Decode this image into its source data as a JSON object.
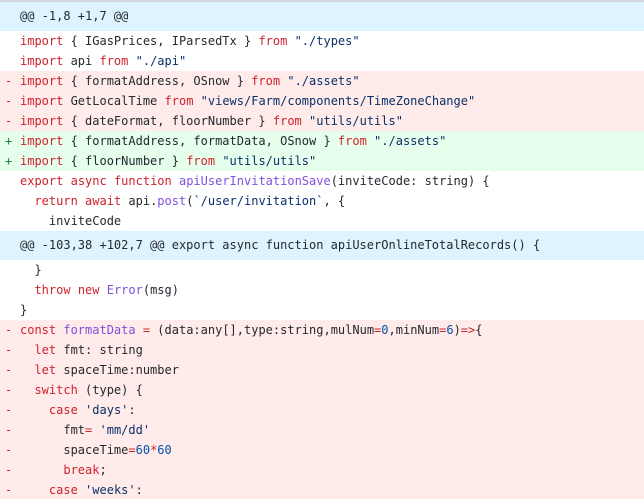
{
  "colors": {
    "hunk_bg": "#ddf4ff",
    "deleted_bg": "#ffebe9",
    "added_bg": "#e6ffec",
    "keyword": "#cf222e",
    "string": "#0a3069",
    "function": "#8250df",
    "number": "#0550ae"
  },
  "diff": {
    "lines": [
      {
        "type": "hunk",
        "sign": "",
        "tokens": [
          {
            "t": "plain",
            "v": "@@ -1,8 +1,7 @@"
          }
        ]
      },
      {
        "type": "ctx",
        "sign": "",
        "tokens": [
          {
            "t": "kw",
            "v": "import"
          },
          {
            "t": "plain",
            "v": " { IGasPrices, IParsedTx } "
          },
          {
            "t": "kw",
            "v": "from"
          },
          {
            "t": "plain",
            "v": " "
          },
          {
            "t": "str",
            "v": "\"./types\""
          }
        ]
      },
      {
        "type": "ctx",
        "sign": "",
        "tokens": [
          {
            "t": "kw",
            "v": "import"
          },
          {
            "t": "plain",
            "v": " api "
          },
          {
            "t": "kw",
            "v": "from"
          },
          {
            "t": "plain",
            "v": " "
          },
          {
            "t": "str",
            "v": "\"./api\""
          }
        ]
      },
      {
        "type": "del",
        "sign": "-",
        "tokens": [
          {
            "t": "kw",
            "v": "import"
          },
          {
            "t": "plain",
            "v": " { formatAddress, OSnow } "
          },
          {
            "t": "kw",
            "v": "from"
          },
          {
            "t": "plain",
            "v": " "
          },
          {
            "t": "str",
            "v": "\"./assets\""
          }
        ]
      },
      {
        "type": "del",
        "sign": "-",
        "tokens": [
          {
            "t": "kw",
            "v": "import"
          },
          {
            "t": "plain",
            "v": " GetLocalTime "
          },
          {
            "t": "kw",
            "v": "from"
          },
          {
            "t": "plain",
            "v": " "
          },
          {
            "t": "str",
            "v": "\"views/Farm/components/TimeZoneChange\""
          }
        ]
      },
      {
        "type": "del",
        "sign": "-",
        "tokens": [
          {
            "t": "kw",
            "v": "import"
          },
          {
            "t": "plain",
            "v": " { dateFormat, floorNumber } "
          },
          {
            "t": "kw",
            "v": "from"
          },
          {
            "t": "plain",
            "v": " "
          },
          {
            "t": "str",
            "v": "\"utils/utils\""
          }
        ]
      },
      {
        "type": "add",
        "sign": "+",
        "tokens": [
          {
            "t": "kw",
            "v": "import"
          },
          {
            "t": "plain",
            "v": " { formatAddress, formatData, OSnow } "
          },
          {
            "t": "kw",
            "v": "from"
          },
          {
            "t": "plain",
            "v": " "
          },
          {
            "t": "str",
            "v": "\"./assets\""
          }
        ]
      },
      {
        "type": "add",
        "sign": "+",
        "tokens": [
          {
            "t": "kw",
            "v": "import"
          },
          {
            "t": "plain",
            "v": " { floorNumber } "
          },
          {
            "t": "kw",
            "v": "from"
          },
          {
            "t": "plain",
            "v": " "
          },
          {
            "t": "str",
            "v": "\"utils/utils\""
          }
        ]
      },
      {
        "type": "ctx",
        "sign": "",
        "tokens": [
          {
            "t": "kw",
            "v": "export"
          },
          {
            "t": "plain",
            "v": " "
          },
          {
            "t": "kw",
            "v": "async"
          },
          {
            "t": "plain",
            "v": " "
          },
          {
            "t": "kw",
            "v": "function"
          },
          {
            "t": "plain",
            "v": " "
          },
          {
            "t": "fn",
            "v": "apiUserInvitationSave"
          },
          {
            "t": "plain",
            "v": "(inviteCode: string) {"
          }
        ]
      },
      {
        "type": "ctx",
        "sign": "",
        "tokens": [
          {
            "t": "plain",
            "v": "  "
          },
          {
            "t": "kw",
            "v": "return"
          },
          {
            "t": "plain",
            "v": " "
          },
          {
            "t": "kw",
            "v": "await"
          },
          {
            "t": "plain",
            "v": " api."
          },
          {
            "t": "fn",
            "v": "post"
          },
          {
            "t": "plain",
            "v": "("
          },
          {
            "t": "str",
            "v": "`/user/invitation`"
          },
          {
            "t": "plain",
            "v": ", {"
          }
        ]
      },
      {
        "type": "ctx",
        "sign": "",
        "tokens": [
          {
            "t": "plain",
            "v": "    inviteCode"
          }
        ]
      },
      {
        "type": "hunk",
        "sign": "",
        "tokens": [
          {
            "t": "plain",
            "v": "@@ -103,38 +102,7 @@ export async function apiUserOnlineTotalRecords() {"
          }
        ]
      },
      {
        "type": "ctx",
        "sign": "",
        "tokens": [
          {
            "t": "plain",
            "v": "  }"
          }
        ]
      },
      {
        "type": "ctx",
        "sign": "",
        "tokens": [
          {
            "t": "plain",
            "v": "  "
          },
          {
            "t": "kw",
            "v": "throw"
          },
          {
            "t": "plain",
            "v": " "
          },
          {
            "t": "kw",
            "v": "new"
          },
          {
            "t": "plain",
            "v": " "
          },
          {
            "t": "fn",
            "v": "Error"
          },
          {
            "t": "plain",
            "v": "(msg)"
          }
        ]
      },
      {
        "type": "ctx",
        "sign": "",
        "tokens": [
          {
            "t": "plain",
            "v": "}"
          }
        ]
      },
      {
        "type": "del",
        "sign": "-",
        "tokens": [
          {
            "t": "kw",
            "v": "const"
          },
          {
            "t": "plain",
            "v": " "
          },
          {
            "t": "fn",
            "v": "formatData"
          },
          {
            "t": "plain",
            "v": " "
          },
          {
            "t": "kw",
            "v": "="
          },
          {
            "t": "plain",
            "v": " (data:any[],type:string,mulNum"
          },
          {
            "t": "kw",
            "v": "="
          },
          {
            "t": "num",
            "v": "0"
          },
          {
            "t": "plain",
            "v": ",minNum"
          },
          {
            "t": "kw",
            "v": "="
          },
          {
            "t": "num",
            "v": "6"
          },
          {
            "t": "plain",
            "v": ")"
          },
          {
            "t": "kw",
            "v": "=>"
          },
          {
            "t": "plain",
            "v": "{"
          }
        ]
      },
      {
        "type": "del",
        "sign": "-",
        "tokens": [
          {
            "t": "plain",
            "v": "  "
          },
          {
            "t": "kw",
            "v": "let"
          },
          {
            "t": "plain",
            "v": " fmt: string"
          }
        ]
      },
      {
        "type": "del",
        "sign": "-",
        "tokens": [
          {
            "t": "plain",
            "v": "  "
          },
          {
            "t": "kw",
            "v": "let"
          },
          {
            "t": "plain",
            "v": " spaceTime:number"
          }
        ]
      },
      {
        "type": "del",
        "sign": "-",
        "tokens": [
          {
            "t": "plain",
            "v": "  "
          },
          {
            "t": "kw",
            "v": "switch"
          },
          {
            "t": "plain",
            "v": " (type) {"
          }
        ]
      },
      {
        "type": "del",
        "sign": "-",
        "tokens": [
          {
            "t": "plain",
            "v": "    "
          },
          {
            "t": "kw",
            "v": "case"
          },
          {
            "t": "plain",
            "v": " "
          },
          {
            "t": "str",
            "v": "'days'"
          },
          {
            "t": "plain",
            "v": ":"
          }
        ]
      },
      {
        "type": "del",
        "sign": "-",
        "tokens": [
          {
            "t": "plain",
            "v": "      fmt"
          },
          {
            "t": "kw",
            "v": "="
          },
          {
            "t": "plain",
            "v": " "
          },
          {
            "t": "str",
            "v": "'mm/dd'"
          }
        ]
      },
      {
        "type": "del",
        "sign": "-",
        "tokens": [
          {
            "t": "plain",
            "v": "      spaceTime"
          },
          {
            "t": "kw",
            "v": "="
          },
          {
            "t": "num",
            "v": "60"
          },
          {
            "t": "kw",
            "v": "*"
          },
          {
            "t": "num",
            "v": "60"
          }
        ]
      },
      {
        "type": "del",
        "sign": "-",
        "tokens": [
          {
            "t": "plain",
            "v": "      "
          },
          {
            "t": "kw",
            "v": "break"
          },
          {
            "t": "plain",
            "v": ";"
          }
        ]
      },
      {
        "type": "del",
        "sign": "-",
        "tokens": [
          {
            "t": "plain",
            "v": "    "
          },
          {
            "t": "kw",
            "v": "case"
          },
          {
            "t": "plain",
            "v": " "
          },
          {
            "t": "str",
            "v": "'weeks'"
          },
          {
            "t": "plain",
            "v": ":"
          }
        ]
      }
    ]
  }
}
